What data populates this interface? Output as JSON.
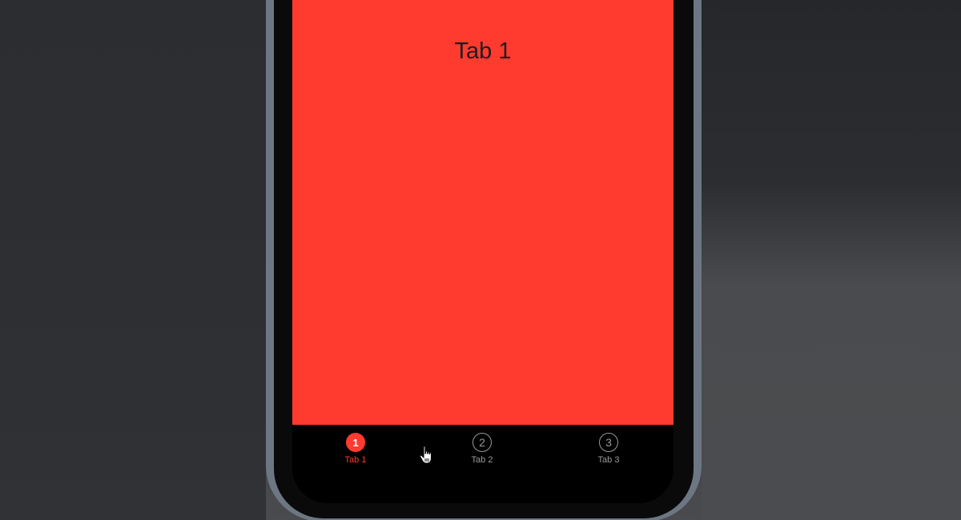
{
  "screen": {
    "title": "Tab 1",
    "background_color": "#ff3b30"
  },
  "tabbar": {
    "tabs": [
      {
        "icon": "1",
        "label": "Tab 1",
        "active": true
      },
      {
        "icon": "2",
        "label": "Tab 2",
        "active": false
      },
      {
        "icon": "3",
        "label": "Tab 3",
        "active": false
      }
    ],
    "active_color": "#ff3b30",
    "inactive_color": "#9a9a9e"
  },
  "cursor": {
    "icon": "hand-pointer-icon"
  }
}
